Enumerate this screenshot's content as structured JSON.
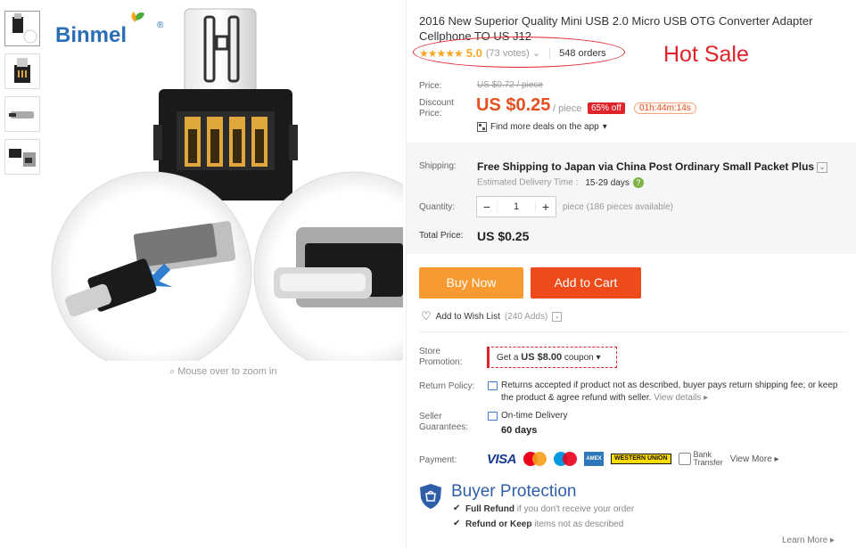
{
  "brand": {
    "logo_text": "Binmel",
    "reg": "®"
  },
  "gallery": {
    "zoom_hint": "Mouse over to zoom in",
    "thumb_count": 4
  },
  "product": {
    "title": "2016 New Superior Quality Mini USB 2.0 Micro USB OTG Converter Adapter Cellphone TO US J12",
    "stars": "★★★★★",
    "score": "5.0",
    "votes": "(73 votes)",
    "orders": "548 orders",
    "annotation": "Hot Sale"
  },
  "pricing": {
    "price_label": "Price:",
    "old_price": "US $0.72 / piece",
    "discount_label_1": "Discount",
    "discount_label_2": "Price:",
    "price": "US $0.25",
    "per_piece": "/ piece",
    "off": "65% off",
    "timer": "01h:44m:14s",
    "app_deals": "Find more deals on the app"
  },
  "shipping": {
    "label": "Shipping:",
    "text": "Free Shipping to Japan via China Post Ordinary Small Packet Plus",
    "est_label": "Estimated Delivery Time :",
    "est_days": "15-29 days"
  },
  "quantity": {
    "label": "Quantity:",
    "minus": "−",
    "value": "1",
    "plus": "+",
    "available": "piece (186 pieces available)"
  },
  "total": {
    "label": "Total Price:",
    "value": "US $0.25"
  },
  "actions": {
    "buy": "Buy Now",
    "cart": "Add to Cart",
    "wish": "Add to Wish List",
    "wish_count": "(240 Adds)"
  },
  "store": {
    "label_1": "Store",
    "label_2": "Promotion:",
    "coupon_pre": "Get a",
    "coupon_amount": "US $8.00",
    "coupon_post": "coupon"
  },
  "returns": {
    "label": "Return Policy:",
    "text": "Returns accepted if product not as described, buyer pays return shipping fee; or keep the product & agree refund with seller.",
    "details": "View details ▸"
  },
  "guarantee": {
    "label_1": "Seller",
    "label_2": "Guarantees:",
    "text": "On-time Delivery",
    "days": "60 days"
  },
  "payment": {
    "label": "Payment:",
    "visa": "VISA",
    "amex": "AMEX",
    "wu": "WESTERN UNION",
    "bank_1": "Bank",
    "bank_2": "Transfer",
    "more": "View More ▸"
  },
  "protection": {
    "title": "Buyer Protection",
    "line1_bold": "Full Refund",
    "line1_rest": "if you don't receive your order",
    "line2_bold": "Refund or Keep",
    "line2_rest": "items not as described",
    "learn": "Learn More ▸"
  },
  "colors": {
    "accent": "#e64f1f",
    "buy": "#f89a2f",
    "cart": "#ef4a1a",
    "protection": "#2e5ea8",
    "annotation": "#e0232b"
  }
}
